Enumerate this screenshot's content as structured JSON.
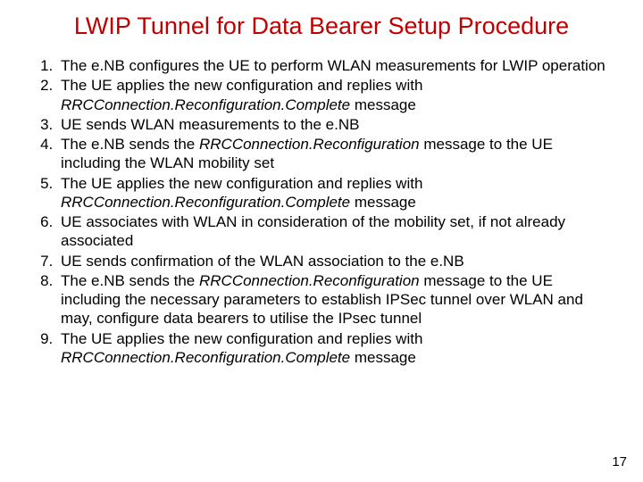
{
  "title": "LWIP Tunnel for Data Bearer Setup Procedure",
  "items": {
    "i1a": "The e.NB configures the UE to perform WLAN measurements for LWIP operation",
    "i2a": "The UE applies the new configuration and replies with ",
    "i2b": "RRCConnection.Reconfiguration.Complete",
    "i2c": " message",
    "i3a": "UE sends WLAN measurements to the e.NB",
    "i4a": "The e.NB sends the ",
    "i4b": "RRCConnection.Reconfiguration",
    "i4c": " message to the UE including the WLAN mobility set",
    "i5a": "The UE applies the new configuration and replies with ",
    "i5b": "RRCConnection.Reconfiguration.Complete",
    "i5c": " message",
    "i6a": "UE associates with WLAN in consideration of the mobility set, if not already associated",
    "i7a": "UE sends confirmation of the WLAN association to the e.NB",
    "i8a": "The e.NB sends the ",
    "i8b": "RRCConnection.Reconfiguration",
    "i8c": " message to the UE including the necessary parameters to establish IPSec tunnel over WLAN and may, configure data bearers to utilise the IPsec tunnel",
    "i9a": "The UE applies the new configuration and replies with ",
    "i9b": "RRCConnection.Reconfiguration.Complete",
    "i9c": " message"
  },
  "page_number": "17"
}
